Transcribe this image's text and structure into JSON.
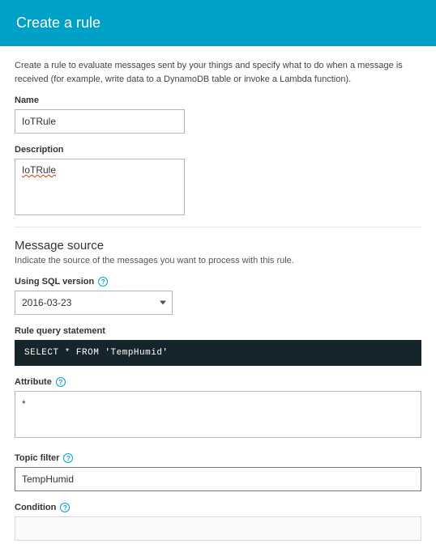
{
  "header": {
    "title": "Create a rule"
  },
  "intro": "Create a rule to evaluate messages sent by your things and specify what to do when a message is received (for example, write data to a DynamoDB table or invoke a Lambda function).",
  "name": {
    "label": "Name",
    "value": "IoTRule"
  },
  "description": {
    "label": "Description",
    "value": "IoTRule"
  },
  "messageSource": {
    "title": "Message source",
    "subtitle": "Indicate the source of the messages you want to process with this rule.",
    "sqlVersion": {
      "label": "Using SQL version",
      "value": "2016-03-23"
    },
    "queryStatement": {
      "label": "Rule query statement",
      "value": "SELECT * FROM 'TempHumid'"
    },
    "attribute": {
      "label": "Attribute",
      "value": "*"
    },
    "topicFilter": {
      "label": "Topic filter",
      "value": "TempHumid"
    },
    "condition": {
      "label": "Condition",
      "value": ""
    }
  }
}
